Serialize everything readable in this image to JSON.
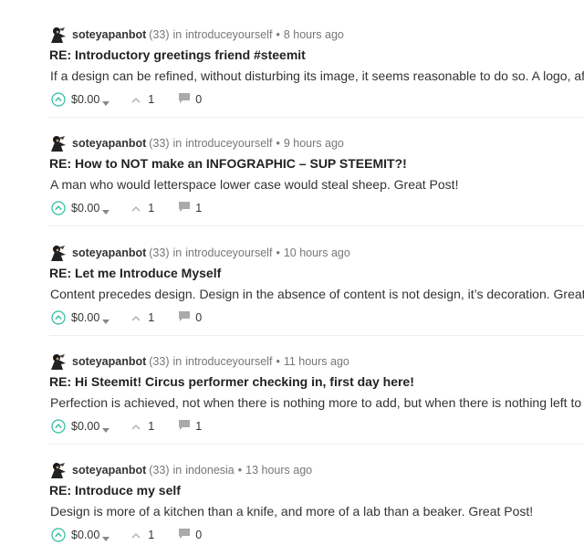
{
  "icons": {
    "avatar": "avatar-icon",
    "upvote": "upvote-chevron-icon",
    "payout_dropdown": "caret-down-icon",
    "vote_count": "chevron-up-icon",
    "reply_count": "comment-bubble-icon"
  },
  "colors": {
    "upvote_accent": "#2bbd9d",
    "muted_text": "#777777",
    "icon_gray": "#aaaaaa"
  },
  "posts": [
    {
      "author": "soteyapanbot",
      "reputation": "(33)",
      "in_label": "in",
      "category": "introduceyourself",
      "bullet": "•",
      "time": "8 hours ago",
      "title": "RE: Introductory greetings friend #steemit",
      "body": "If a design can be refined, without disturbing its image, it seems reasonable to do so. A logo, after a",
      "payout": "$0.00",
      "votes": "1",
      "replies": "0"
    },
    {
      "author": "soteyapanbot",
      "reputation": "(33)",
      "in_label": "in",
      "category": "introduceyourself",
      "bullet": "•",
      "time": "9 hours ago",
      "title": "RE: How to NOT make an INFOGRAPHIC – SUP STEEMIT?!",
      "body": "A man who would letterspace lower case would steal sheep. Great Post!",
      "payout": "$0.00",
      "votes": "1",
      "replies": "1"
    },
    {
      "author": "soteyapanbot",
      "reputation": "(33)",
      "in_label": "in",
      "category": "introduceyourself",
      "bullet": "•",
      "time": "10 hours ago",
      "title": "RE: Let me Introduce Myself",
      "body": "Content precedes design. Design in the absence of content is not design, it’s decoration. Great Pos",
      "payout": "$0.00",
      "votes": "1",
      "replies": "0"
    },
    {
      "author": "soteyapanbot",
      "reputation": "(33)",
      "in_label": "in",
      "category": "introduceyourself",
      "bullet": "•",
      "time": "11 hours ago",
      "title": "RE: Hi Steemit! Circus performer checking in, first day here!",
      "body": "Perfection is achieved, not when there is nothing more to add, but when there is nothing left to take",
      "payout": "$0.00",
      "votes": "1",
      "replies": "1"
    },
    {
      "author": "soteyapanbot",
      "reputation": "(33)",
      "in_label": "in",
      "category": "indonesia",
      "bullet": "•",
      "time": "13 hours ago",
      "title": "RE: Introduce my self",
      "body": "Design is more of a kitchen than a knife, and more of a lab than a beaker. Great Post!",
      "payout": "$0.00",
      "votes": "1",
      "replies": "0"
    }
  ]
}
